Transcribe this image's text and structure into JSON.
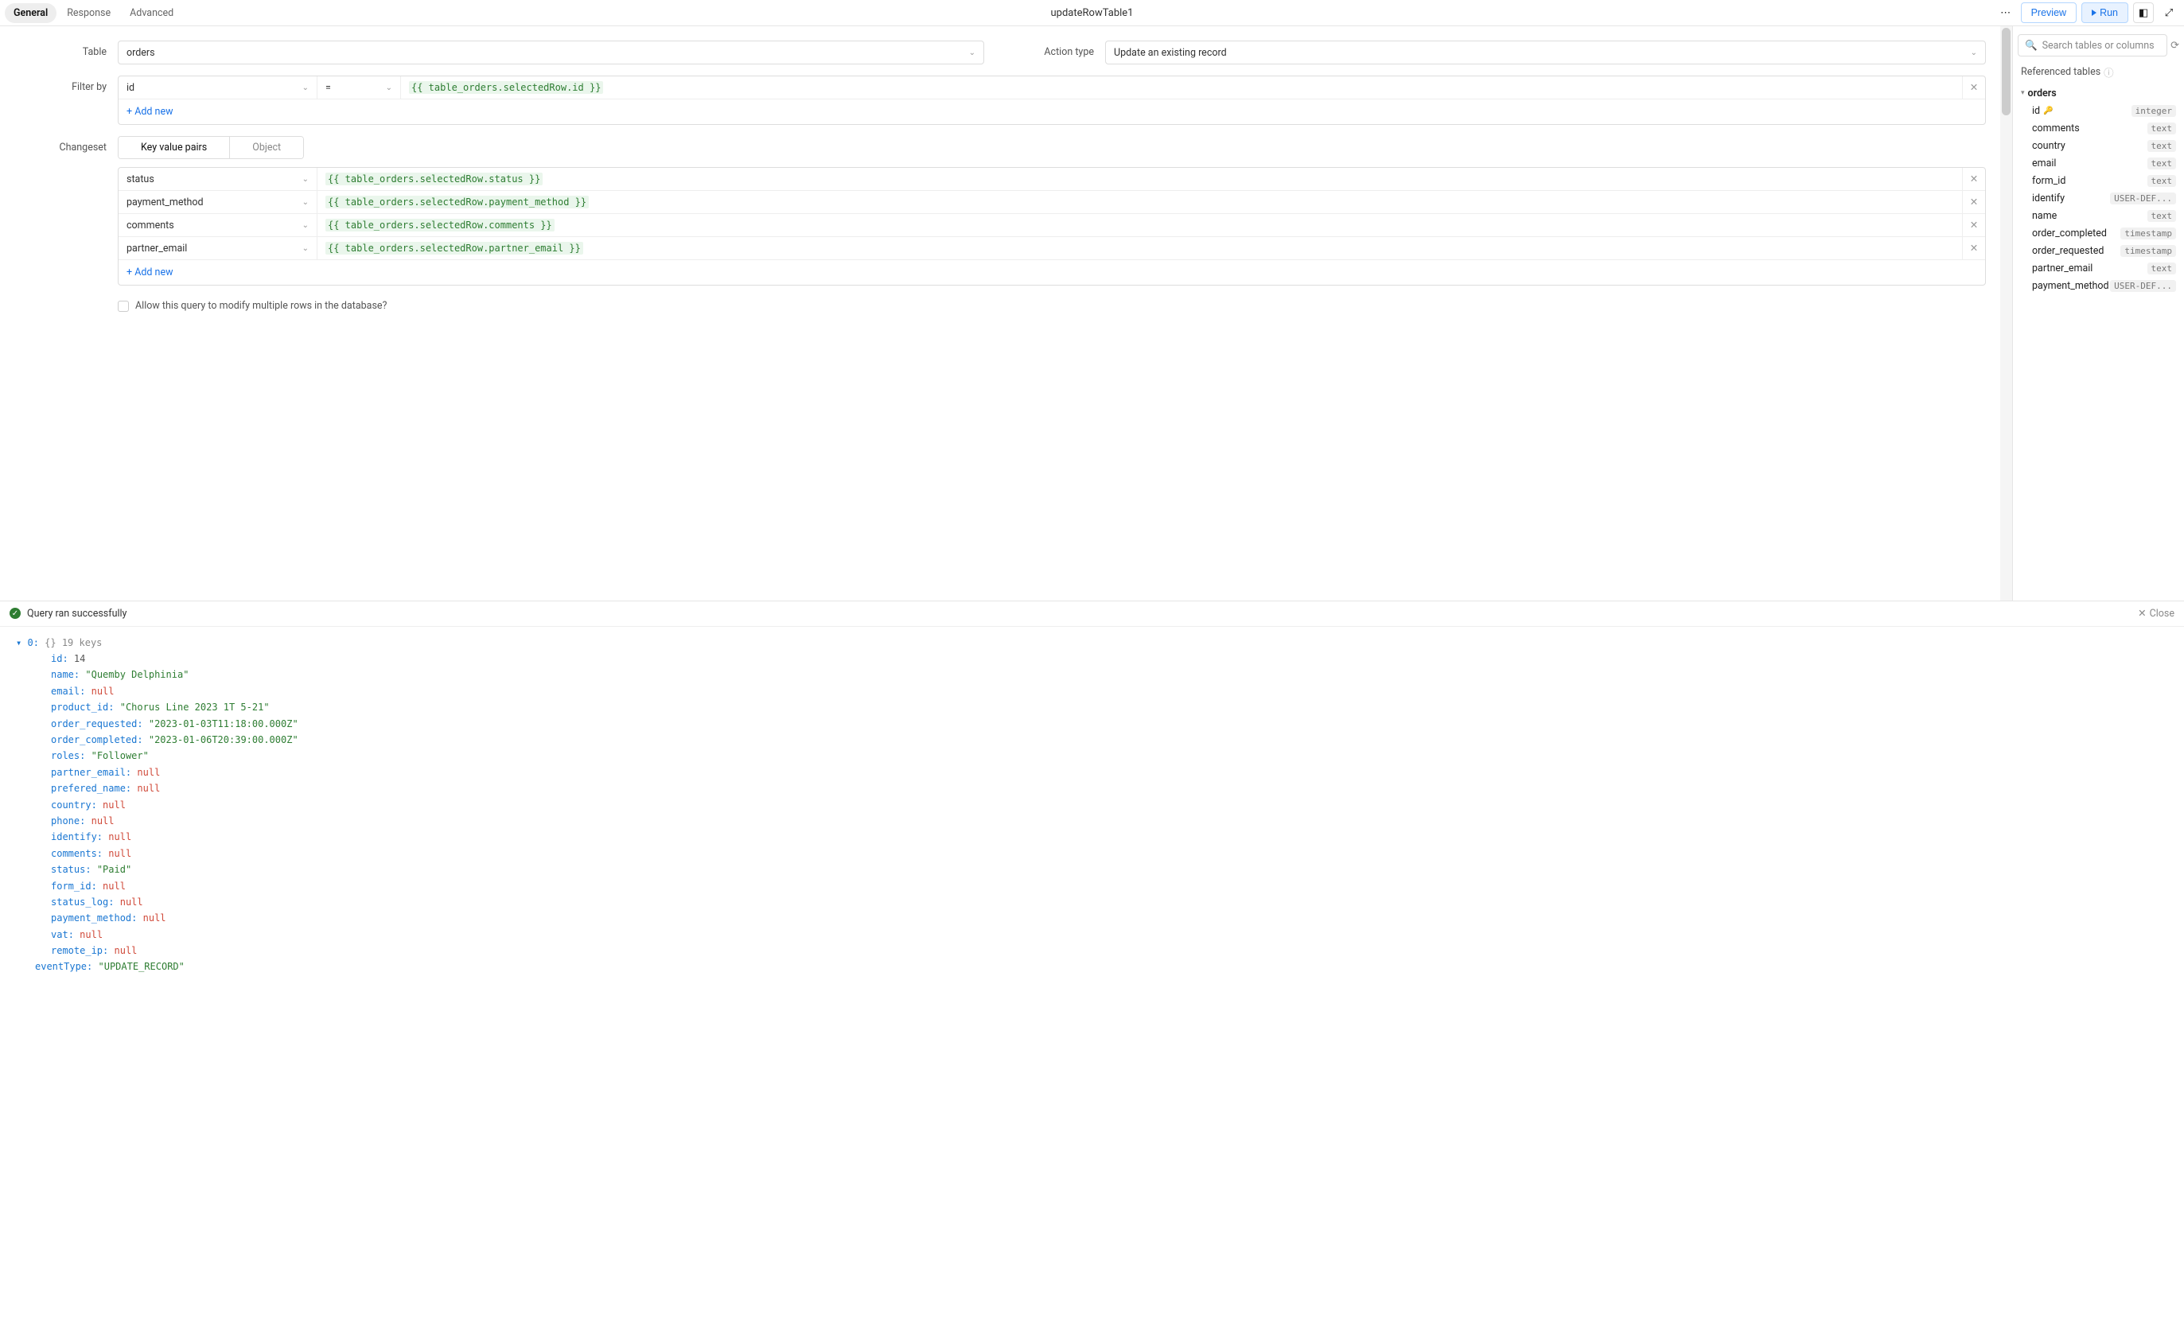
{
  "header": {
    "tabs": [
      "General",
      "Response",
      "Advanced"
    ],
    "active_tab": 0,
    "title": "updateRowTable1",
    "preview_label": "Preview",
    "run_label": "Run"
  },
  "form": {
    "table_label": "Table",
    "table_value": "orders",
    "action_label": "Action type",
    "action_value": "Update an existing record",
    "filter_label": "Filter by",
    "filter": {
      "column": "id",
      "operator": "=",
      "expr": "{{ table_orders.selectedRow.id }}",
      "add_new": "+ Add new"
    },
    "changeset_label": "Changeset",
    "changeset_modes": [
      "Key value pairs",
      "Object"
    ],
    "changeset_active": 0,
    "changeset_rows": [
      {
        "key": "status",
        "expr": "{{ table_orders.selectedRow.status }}"
      },
      {
        "key": "payment_method",
        "expr": "{{ table_orders.selectedRow.payment_method }}"
      },
      {
        "key": "comments",
        "expr": "{{ table_orders.selectedRow.comments }}"
      },
      {
        "key": "partner_email",
        "expr": "{{ table_orders.selectedRow.partner_email }}"
      }
    ],
    "changeset_add": "+ Add new",
    "allow_multi": "Allow this query to modify multiple rows in the database?"
  },
  "sidebar": {
    "search_placeholder": "Search tables or columns",
    "section": "Referenced tables",
    "table_name": "orders",
    "columns": [
      {
        "name": "id",
        "type": "integer",
        "pk": true
      },
      {
        "name": "comments",
        "type": "text"
      },
      {
        "name": "country",
        "type": "text"
      },
      {
        "name": "email",
        "type": "text"
      },
      {
        "name": "form_id",
        "type": "text"
      },
      {
        "name": "identify",
        "type": "USER-DEF..."
      },
      {
        "name": "name",
        "type": "text"
      },
      {
        "name": "order_completed",
        "type": "timestamp"
      },
      {
        "name": "order_requested",
        "type": "timestamp"
      },
      {
        "name": "partner_email",
        "type": "text"
      },
      {
        "name": "payment_method",
        "type": "USER-DEF..."
      }
    ]
  },
  "result": {
    "status": "Query ran successfully",
    "close": "Close",
    "root_idx": "0",
    "root_meta": "{}  19 keys",
    "rows": [
      {
        "k": "id",
        "v": 14,
        "t": "num"
      },
      {
        "k": "name",
        "v": "\"Quemby Delphinia\"",
        "t": "str"
      },
      {
        "k": "email",
        "v": "null",
        "t": "null"
      },
      {
        "k": "product_id",
        "v": "\"Chorus Line 2023 1T 5-21\"",
        "t": "str"
      },
      {
        "k": "order_requested",
        "v": "\"2023-01-03T11:18:00.000Z\"",
        "t": "str"
      },
      {
        "k": "order_completed",
        "v": "\"2023-01-06T20:39:00.000Z\"",
        "t": "str"
      },
      {
        "k": "roles",
        "v": "\"Follower\"",
        "t": "str"
      },
      {
        "k": "partner_email",
        "v": "null",
        "t": "null"
      },
      {
        "k": "prefered_name",
        "v": "null",
        "t": "null"
      },
      {
        "k": "country",
        "v": "null",
        "t": "null"
      },
      {
        "k": "phone",
        "v": "null",
        "t": "null"
      },
      {
        "k": "identify",
        "v": "null",
        "t": "null"
      },
      {
        "k": "comments",
        "v": "null",
        "t": "null"
      },
      {
        "k": "status",
        "v": "\"Paid\"",
        "t": "str"
      },
      {
        "k": "form_id",
        "v": "null",
        "t": "null"
      },
      {
        "k": "status_log",
        "v": "null",
        "t": "null"
      },
      {
        "k": "payment_method",
        "v": "null",
        "t": "null"
      },
      {
        "k": "vat",
        "v": "null",
        "t": "null"
      },
      {
        "k": "remote_ip",
        "v": "null",
        "t": "null"
      }
    ],
    "event_key": "eventType",
    "event_val": "\"UPDATE_RECORD\""
  }
}
